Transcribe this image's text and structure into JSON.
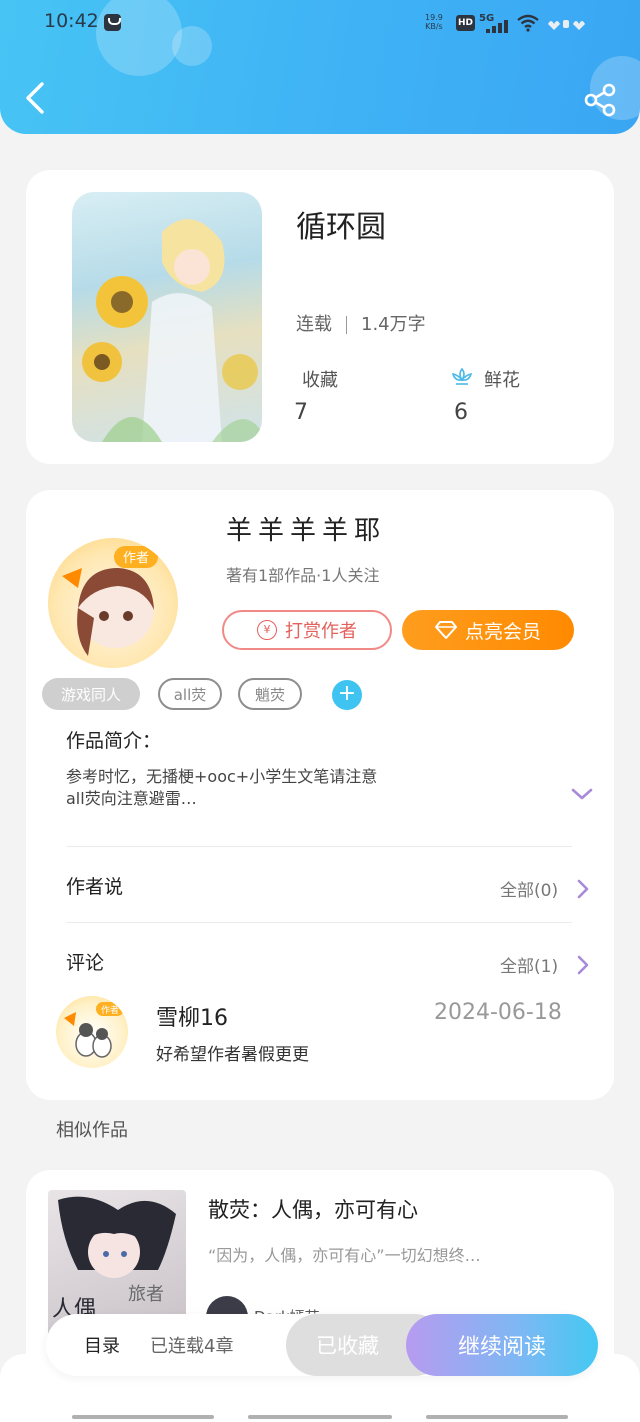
{
  "status_bar": {
    "time": "10:42",
    "speed_value": "19.9",
    "speed_unit": "KB/s",
    "hd": "HD",
    "network": "5G"
  },
  "book": {
    "title": "循环圆",
    "status": "连载",
    "word_count": "1.4万字",
    "favorites_label": "收藏",
    "favorites_value": "7",
    "flowers_label": "鲜花",
    "flowers_value": "6"
  },
  "author": {
    "name": "羊羊羊羊耶",
    "meta": "著有1部作品·1人关注",
    "tip_label": "打赏作者",
    "vip_label": "点亮会员",
    "badge": "作者"
  },
  "tags": [
    "游戏同人",
    "all荧",
    "魈荧"
  ],
  "intro": {
    "label": "作品简介：",
    "line1": "参考时忆，无播梗+ooc+小学生文笔请注意",
    "line2": "all荧向注意避雷…"
  },
  "author_says": {
    "label": "作者说",
    "all": "全部(0)"
  },
  "comments": {
    "label": "评论",
    "all": "全部(1)",
    "items": [
      {
        "name": "雪柳16",
        "date": "2024-06-18",
        "text": "好希望作者暑假更更",
        "badge": "作者"
      }
    ]
  },
  "similar": {
    "label": "相似作品",
    "items": [
      {
        "title": "散荧：人偶，亦可有心",
        "desc": "“因为，人偶，亦可有心”一切幻想终…",
        "cover_text_a": "人偶",
        "cover_text_b": "旅者",
        "author": "Dark嫣茹"
      }
    ]
  },
  "bottom_bar": {
    "toc": "目录",
    "toc_status": "已连载4章",
    "collected": "已收藏",
    "continue": "继续阅读"
  },
  "colors": {
    "header": "#3fb2f5",
    "accent_orange": "#ff8a00",
    "accent_red": "#e2615c",
    "accent_blue": "#3fc4f2",
    "chevron": "#a98ad8"
  }
}
